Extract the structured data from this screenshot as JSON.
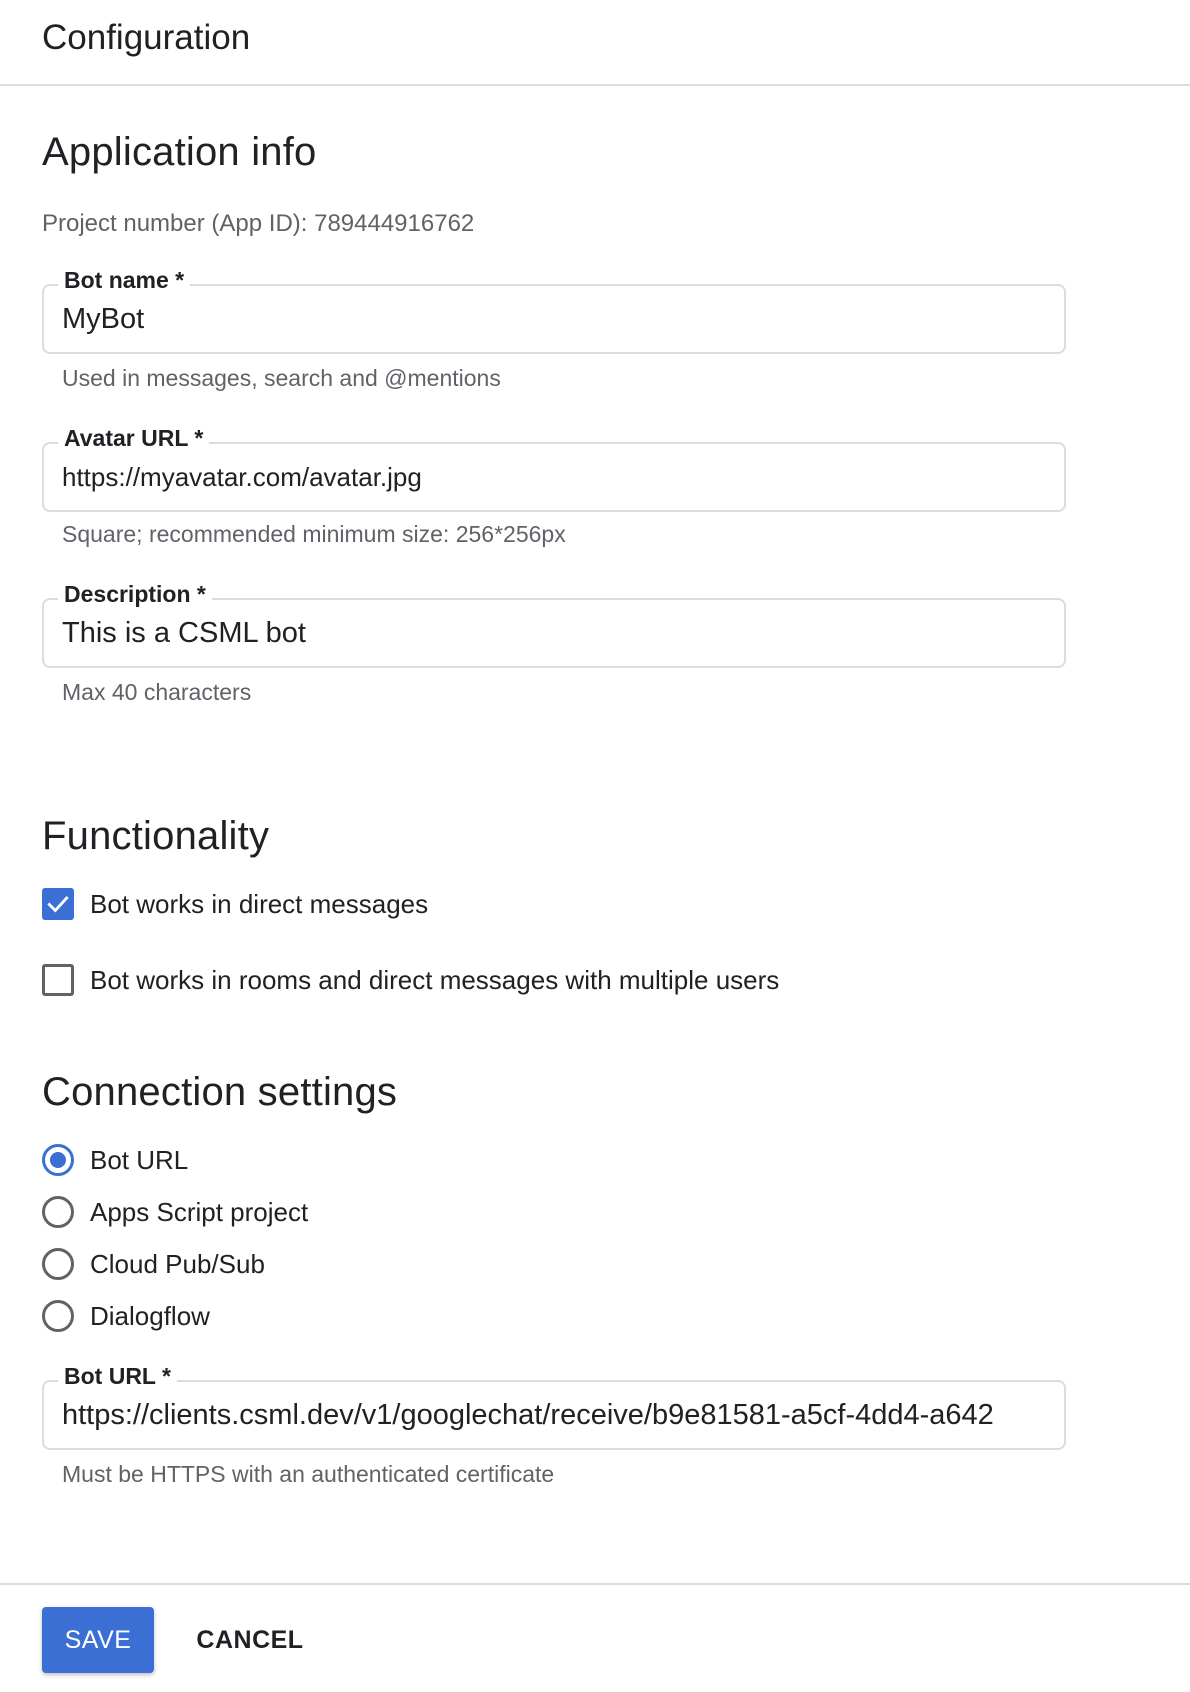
{
  "header": {
    "title": "Configuration"
  },
  "application_info": {
    "title": "Application info",
    "project_number": "Project number (App ID): 789444916762",
    "bot_name": {
      "label": "Bot name *",
      "value": "MyBot",
      "helper": "Used in messages, search and @mentions"
    },
    "avatar_url": {
      "label": "Avatar URL *",
      "value": "https://myavatar.com/avatar.jpg",
      "helper": "Square; recommended minimum size: 256*256px"
    },
    "description": {
      "label": "Description *",
      "value": "This is a CSML bot",
      "helper": "Max 40 characters"
    }
  },
  "functionality": {
    "title": "Functionality",
    "options": [
      {
        "label": "Bot works in direct messages",
        "checked": true
      },
      {
        "label": "Bot works in rooms and direct messages with multiple users",
        "checked": false
      }
    ]
  },
  "connection_settings": {
    "title": "Connection settings",
    "options": [
      {
        "label": "Bot URL",
        "selected": true
      },
      {
        "label": "Apps Script project",
        "selected": false
      },
      {
        "label": "Cloud Pub/Sub",
        "selected": false
      },
      {
        "label": "Dialogflow",
        "selected": false
      }
    ],
    "bot_url": {
      "label": "Bot URL *",
      "value": "https://clients.csml.dev/v1/googlechat/receive/b9e81581-a5cf-4dd4-a642",
      "helper": "Must be HTTPS with an authenticated certificate"
    }
  },
  "footer": {
    "save_label": "SAVE",
    "cancel_label": "CANCEL"
  },
  "colors": {
    "accent": "#3b6fd4",
    "border": "#dadce0",
    "text_primary": "#202124",
    "text_secondary": "#5f6368"
  },
  "icons": {
    "checkmark": "check-icon"
  }
}
